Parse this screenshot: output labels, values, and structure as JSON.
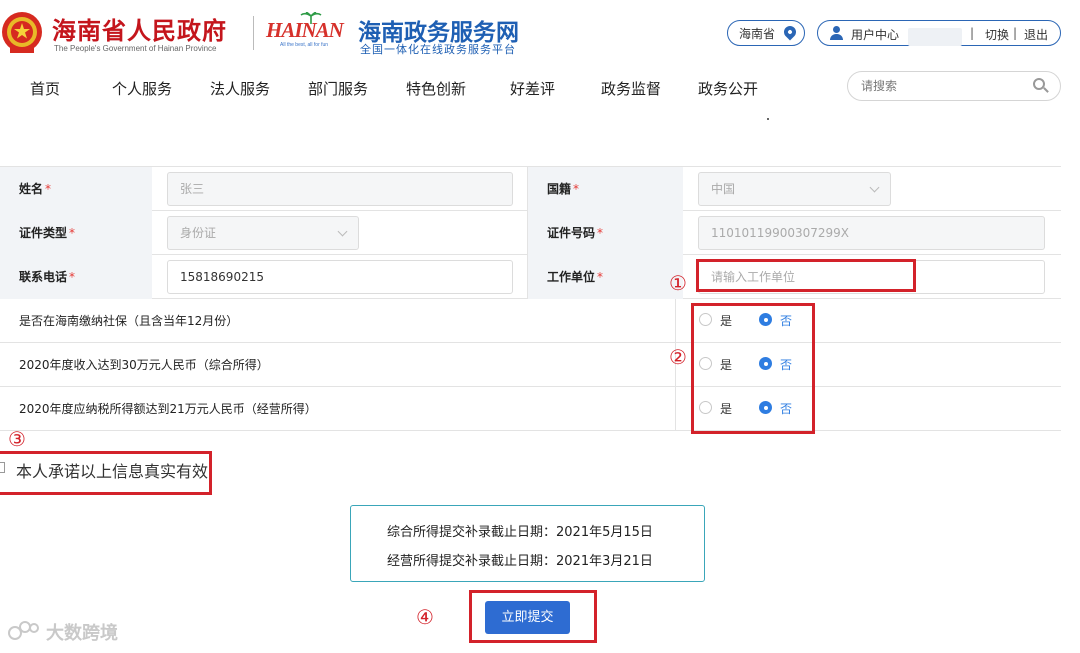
{
  "header": {
    "gov_title": "海南省人民政府",
    "gov_subtitle": "The People's Government of Hainan Province",
    "hainan_word": "HAINAN",
    "hainan_tag": "All the best, all for fun",
    "portal_title": "海南政务服务网",
    "portal_subtitle": "全国一体化在线政务服务平台",
    "region": "海南省",
    "user_center": "用户中心",
    "switch_label": "切换",
    "logout_label": "退出",
    "separator": "|"
  },
  "nav": {
    "items": [
      "首页",
      "个人服务",
      "法人服务",
      "部门服务",
      "特色创新",
      "好差评",
      "政务监督",
      "政务公开"
    ],
    "search_placeholder": "请搜索"
  },
  "form": {
    "name_label": "姓名",
    "name_value": "张三",
    "nationality_label": "国籍",
    "nationality_value": "中国",
    "id_type_label": "证件类型",
    "id_type_value": "身份证",
    "id_number_label": "证件号码",
    "id_number_value": "11010119900307299X",
    "phone_label": "联系电话",
    "phone_value": "15818690215",
    "employer_label": "工作单位",
    "employer_placeholder": "请输入工作单位",
    "required_mark": "*",
    "questions": [
      {
        "text": "是否在海南缴纳社保（且含当年12月份）",
        "yes": "是",
        "no": "否",
        "selected": "no"
      },
      {
        "text": "2020年度收入达到30万元人民币（综合所得）",
        "yes": "是",
        "no": "否",
        "selected": "no"
      },
      {
        "text": "2020年度应纳税所得额达到21万元人民币（经营所得）",
        "yes": "是",
        "no": "否",
        "selected": "no"
      }
    ],
    "commitment": "本人承诺以上信息真实有效"
  },
  "deadlines": {
    "line1": "综合所得提交补录截止日期：2021年5月15日",
    "line2": "经营所得提交补录截止日期：2021年3月21日"
  },
  "submit_label": "立即提交",
  "annotations": [
    "①",
    "②",
    "③",
    "④"
  ],
  "watermark": "大数跨境",
  "colors": {
    "gov_red": "#c4151c",
    "portal_blue": "#1e5fb3",
    "annotation_red": "#d3222a",
    "radio_blue": "#2e7de1",
    "button_blue": "#2e6cd2"
  }
}
